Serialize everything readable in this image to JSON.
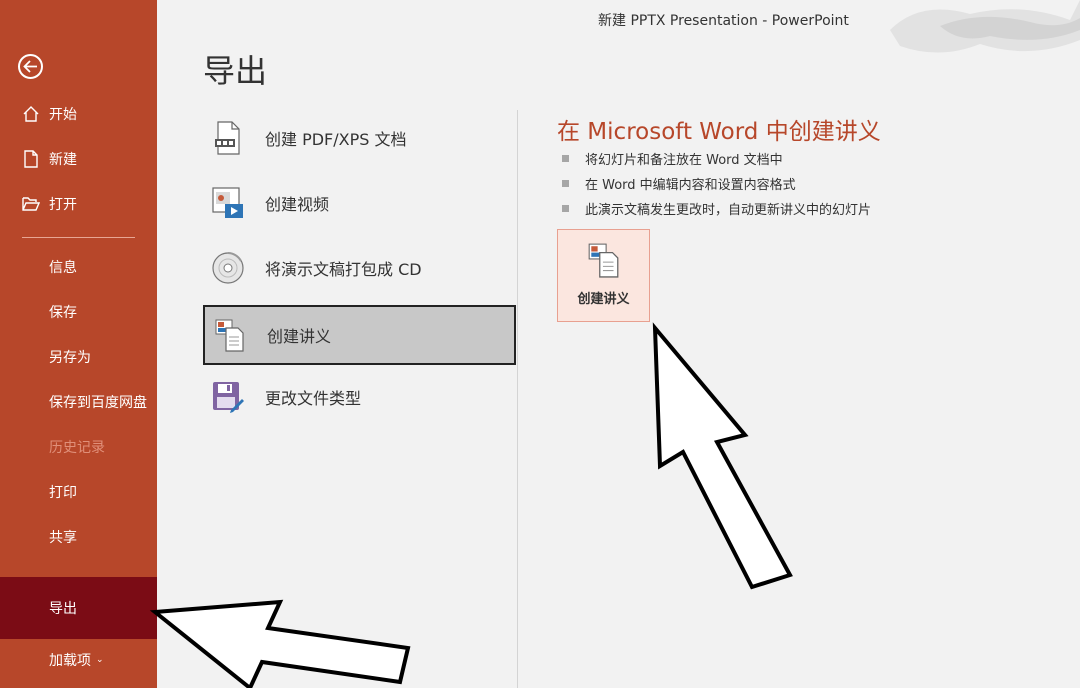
{
  "window": {
    "title": "新建 PPTX Presentation  -  PowerPoint"
  },
  "sidebar": {
    "items": [
      {
        "label": "开始",
        "icon": "home-icon"
      },
      {
        "label": "新建",
        "icon": "new-document-icon"
      },
      {
        "label": "打开",
        "icon": "open-folder-icon"
      },
      {
        "label": "信息"
      },
      {
        "label": "保存"
      },
      {
        "label": "另存为"
      },
      {
        "label": "保存到百度网盘"
      },
      {
        "label": "历史记录",
        "disabled": true
      },
      {
        "label": "打印"
      },
      {
        "label": "共享"
      },
      {
        "label": "导出",
        "active": true
      },
      {
        "label": "加载项",
        "has_dropdown": true
      }
    ]
  },
  "page": {
    "title": "导出"
  },
  "export_options": [
    {
      "label": "创建 PDF/XPS 文档",
      "icon": "pdf-document-icon"
    },
    {
      "label": "创建视频",
      "icon": "video-icon"
    },
    {
      "label": "将演示文稿打包成 CD",
      "icon": "cd-icon"
    },
    {
      "label": "创建讲义",
      "icon": "handout-icon",
      "selected": true
    },
    {
      "label": "更改文件类型",
      "icon": "file-type-icon"
    }
  ],
  "detail": {
    "title": "在 Microsoft Word 中创建讲义",
    "bullets": [
      "将幻灯片和备注放在 Word 文档中",
      "在 Word 中编辑内容和设置内容格式",
      "此演示文稿发生更改时，自动更新讲义中的幻灯片"
    ],
    "button_label": "创建讲义"
  },
  "colors": {
    "accent": "#b7472a",
    "active_nav": "#7b0c15",
    "selected_option": "#c8c8c8",
    "button_bg": "#fbe6df"
  }
}
